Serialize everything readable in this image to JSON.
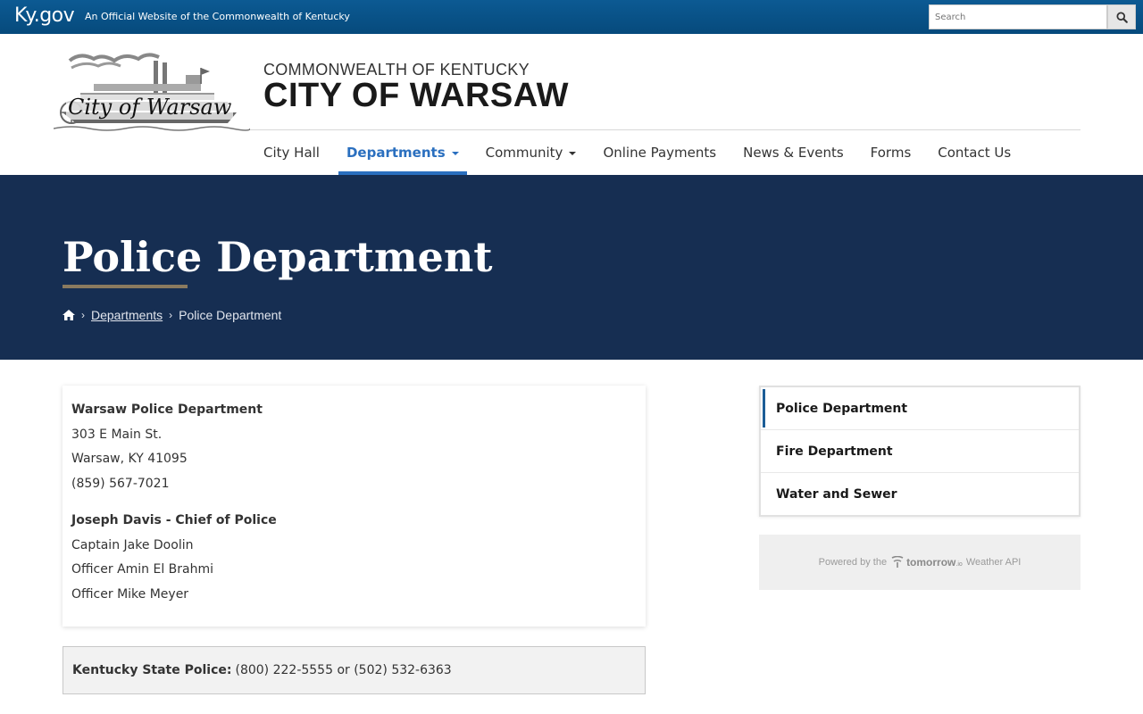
{
  "govbar": {
    "logo_text": "Ky.gov",
    "official_text": "An Official Website of the Commonwealth of Kentucky",
    "search_placeholder": "Search"
  },
  "header": {
    "supertitle": "COMMONWEALTH OF KENTUCKY",
    "title": "CITY OF WARSAW",
    "logo_script": "City of Warsaw"
  },
  "nav": {
    "items": [
      {
        "label": "City Hall"
      },
      {
        "label": "Departments"
      },
      {
        "label": "Community"
      },
      {
        "label": "Online Payments"
      },
      {
        "label": "News & Events"
      },
      {
        "label": "Forms"
      },
      {
        "label": "Contact Us"
      }
    ]
  },
  "hero": {
    "title": "Police Department",
    "breadcrumb": {
      "link": "Departments",
      "current": "Police Department"
    }
  },
  "main": {
    "org_name": "Warsaw Police Department",
    "address1": "303 E Main St.",
    "address2": "Warsaw, KY 41095",
    "phone": " (859) 567-7021",
    "chief": "Joseph Davis  - Chief of Police",
    "staff": [
      "Captain Jake Doolin",
      "Officer Amin El Brahmi",
      "Officer Mike Meyer"
    ]
  },
  "alert": {
    "label": "Kentucky State Police:",
    "text": "(800) 222-5555 or (502) 532-6363"
  },
  "sidebar": {
    "items": [
      {
        "label": "Police Department"
      },
      {
        "label": "Fire Department"
      },
      {
        "label": "Water and Sewer"
      }
    ]
  },
  "weather": {
    "prefix": "Powered by the",
    "brand": "tomorrow",
    "brand_suffix": ".io",
    "suffix": "Weather API"
  },
  "colors": {
    "gov_blue": "#0c5a93",
    "hero_navy": "#162e52",
    "accent_blue": "#2a6fbf",
    "hero_rule": "#8a7a5f"
  }
}
